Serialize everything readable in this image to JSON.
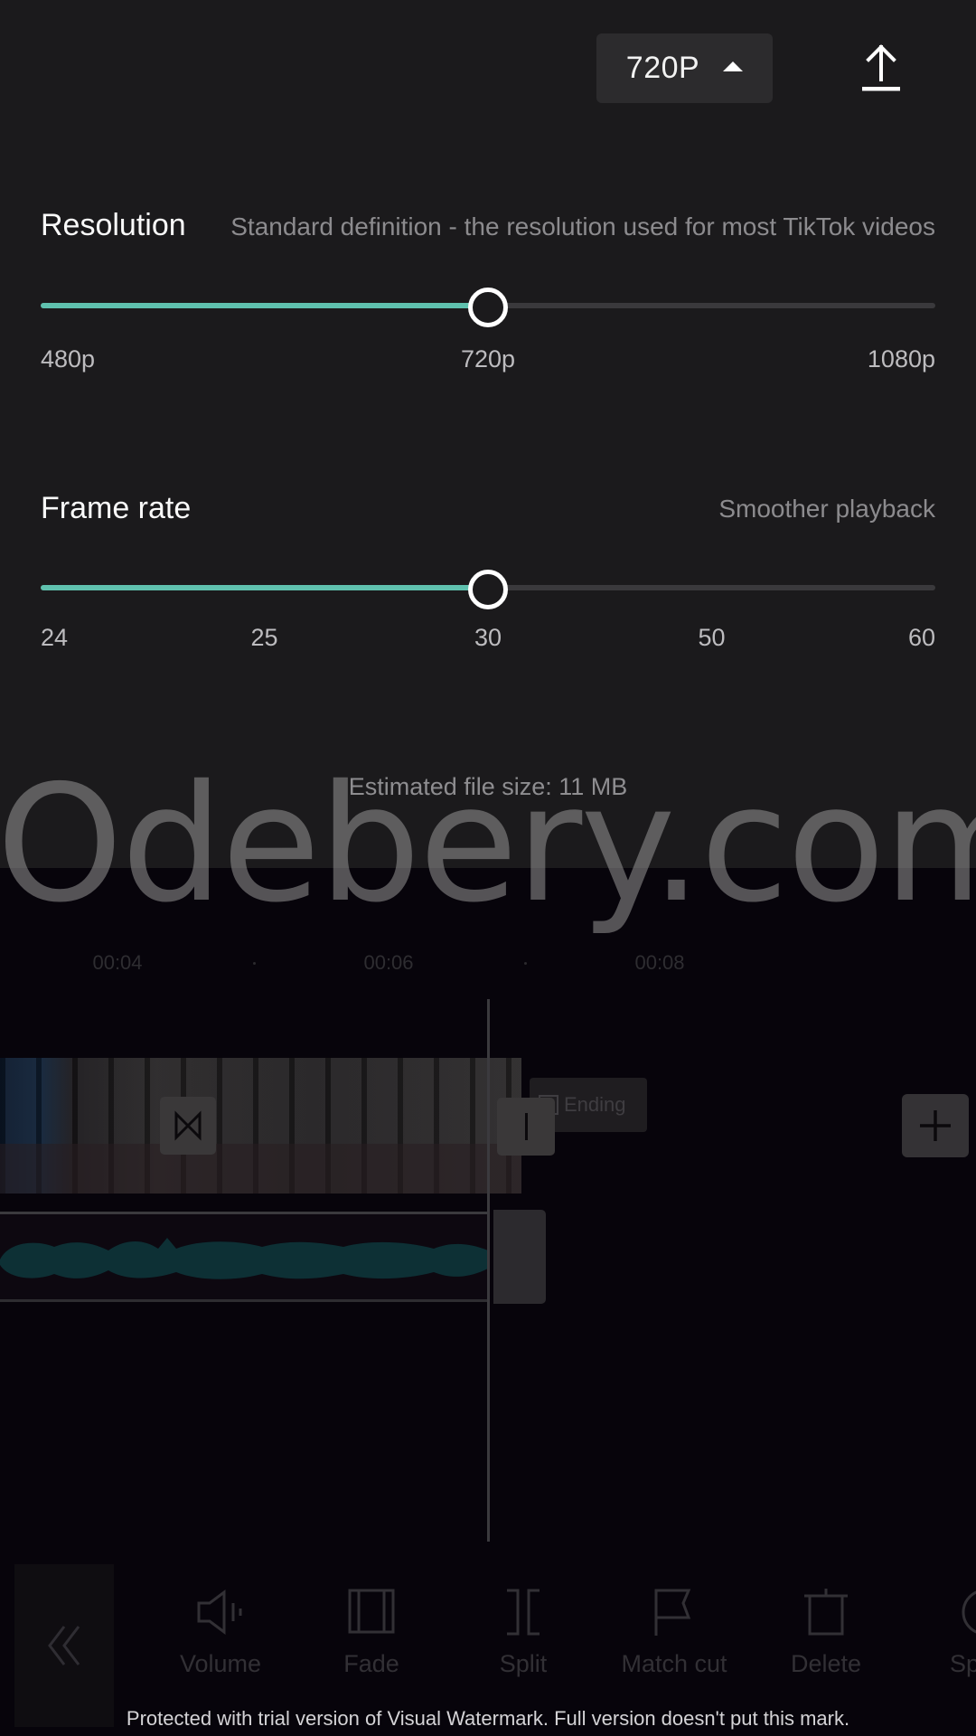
{
  "header": {
    "resolution_dropdown": {
      "value": "720P",
      "icon": "caret-up-icon"
    },
    "upload_icon": "upload-icon"
  },
  "resolution": {
    "title": "Resolution",
    "description": "Standard definition - the resolution used for most TikTok videos",
    "ticks": [
      "480p",
      "720p",
      "1080p"
    ],
    "selected": "720p",
    "fraction": 0.5
  },
  "frame_rate": {
    "title": "Frame rate",
    "description": "Smoother playback",
    "ticks": [
      "24",
      "25",
      "30",
      "50",
      "60"
    ],
    "selected": "30",
    "fraction": 0.5
  },
  "estimated_file_size": "Estimated file size: 11 MB",
  "editor": {
    "ruler": [
      "00:04",
      "00:06",
      "00:08"
    ],
    "ending_label": "Ending",
    "toolbar": [
      {
        "label": "Volume",
        "icon": "volume-icon"
      },
      {
        "label": "Fade",
        "icon": "fade-icon"
      },
      {
        "label": "Split",
        "icon": "split-icon"
      },
      {
        "label": "Match cut",
        "icon": "flag-icon"
      },
      {
        "label": "Delete",
        "icon": "trash-icon"
      },
      {
        "label": "Speed",
        "icon": "speed-icon"
      }
    ]
  },
  "watermarks": {
    "overlay": "Odebery.com",
    "footer": "Protected with trial version of Visual Watermark. Full version doesn't put this mark."
  },
  "colors": {
    "accent": "#5fc1ae",
    "panel_bg": "#1b1a1c",
    "track": "#3a393c"
  }
}
